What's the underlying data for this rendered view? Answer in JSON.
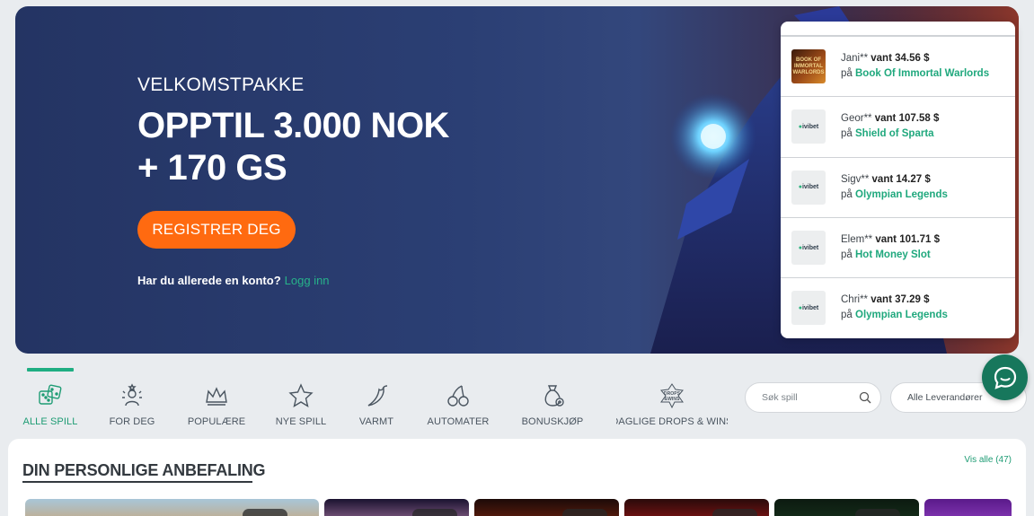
{
  "hero": {
    "kicker": "VELKOMSTPAKKE",
    "title_line1": "OPPTIL 3.000 NOK",
    "title_line2": "+ 170 GS",
    "cta_label": "REGISTRER DEG",
    "login_prompt": "Har du allerede en konto?",
    "login_link": "Logg inn"
  },
  "winners": [
    {
      "name": "Jani**",
      "won_label": "vant",
      "amount": "34.56 $",
      "on": "på",
      "game": "Book Of Immortal Warlords",
      "thumb": "BOOK OF IMMORTAL WARLORDS",
      "thumb_type": "slot-art"
    },
    {
      "name": "Geor**",
      "won_label": "vant",
      "amount": "107.58 $",
      "on": "på",
      "game": "Shield of Sparta",
      "thumb": "ivibet",
      "thumb_type": "logo"
    },
    {
      "name": "Sigv**",
      "won_label": "vant",
      "amount": "14.27 $",
      "on": "på",
      "game": "Olympian Legends",
      "thumb": "ivibet",
      "thumb_type": "logo"
    },
    {
      "name": "Elem**",
      "won_label": "vant",
      "amount": "101.71 $",
      "on": "på",
      "game": "Hot Money Slot",
      "thumb": "ivibet",
      "thumb_type": "logo"
    },
    {
      "name": "Chri**",
      "won_label": "vant",
      "amount": "37.29 $",
      "on": "på",
      "game": "Olympian Legends",
      "thumb": "ivibet",
      "thumb_type": "logo"
    }
  ],
  "categories": [
    {
      "label": "ALLE SPILL",
      "icon": "dice-icon",
      "active": true
    },
    {
      "label": "FOR DEG",
      "icon": "user-star-icon",
      "active": false
    },
    {
      "label": "POPULÆRE",
      "icon": "crown-icon",
      "active": false
    },
    {
      "label": "NYE SPILL",
      "icon": "star-icon",
      "active": false
    },
    {
      "label": "VARMT",
      "icon": "chili-icon",
      "active": false
    },
    {
      "label": "AUTOMATER",
      "icon": "cherry-icon",
      "active": false
    },
    {
      "label": "BONUSKJØP",
      "icon": "money-bag-icon",
      "active": false
    },
    {
      "label": "DAGLIGE DROPS & WINS",
      "icon": "drops-wins-icon",
      "active": false
    }
  ],
  "search": {
    "placeholder": "Søk spill"
  },
  "provider": {
    "label": "Alle Leverandører"
  },
  "recommendations": {
    "title": "DIN PERSONLIGE ANBEFALING",
    "view_all": "Vis alle",
    "count": "(47)"
  },
  "colors": {
    "accent": "#1fae82",
    "cta": "#ff6a10",
    "hero_bg": "#243463",
    "chat": "#17775c"
  }
}
